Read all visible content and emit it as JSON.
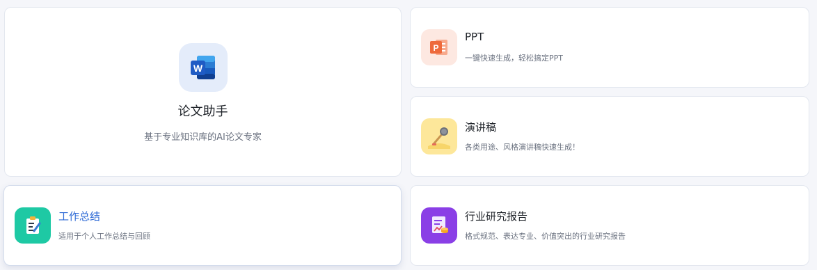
{
  "hero": {
    "icon": "word-document-icon",
    "title": "论文助手",
    "description": "基于专业知识库的AI论文专家"
  },
  "cards": [
    {
      "icon": "ppt-icon",
      "title": "PPT",
      "description": "一键快速生成，轻松搞定PPT"
    },
    {
      "icon": "microphone-icon",
      "title": "演讲稿",
      "description": "各类用途、风格演讲稿快速生成！"
    },
    {
      "icon": "clipboard-pen-icon",
      "title": "工作总结",
      "description": "适用于个人工作总结与回顾"
    },
    {
      "icon": "report-chart-icon",
      "title": "行业研究报告",
      "description": "格式规范、表达专业、价值突出的行业研究报告"
    }
  ],
  "colors": {
    "page_background": "#f5f6fa",
    "card_border": "#e3e7ef",
    "hover_title": "#2f6bd6",
    "word_blue": "#1f5bc4",
    "ppt_orange": "#ee6a3c",
    "speech_yellow": "#fde79a",
    "work_green": "#1ec9a4",
    "research_purple": "#8a3fe6"
  }
}
